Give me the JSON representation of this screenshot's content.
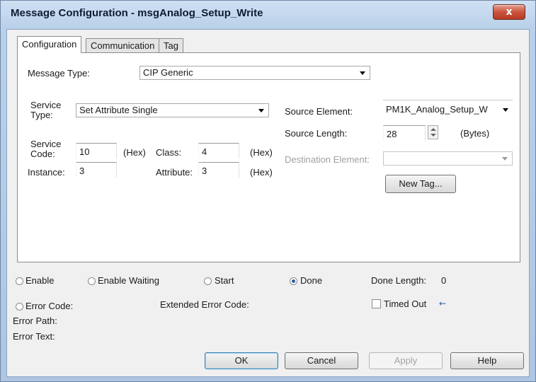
{
  "window": {
    "title": "Message Configuration - msgAnalog_Setup_Write",
    "close_glyph": "x"
  },
  "tabs": [
    {
      "label": "Configuration",
      "active": true
    },
    {
      "label": "Communication",
      "active": false
    },
    {
      "label": "Tag",
      "active": false
    }
  ],
  "config": {
    "message_type_label": "Message Type:",
    "message_type_value": "CIP Generic",
    "service_type_label_1": "Service",
    "service_type_label_2": "Type:",
    "service_type_value": "Set Attribute Single",
    "service_code_label_1": "Service",
    "service_code_label_2": "Code:",
    "service_code_value": "10",
    "hex_label": "(Hex)",
    "class_label": "Class:",
    "class_value": "4",
    "instance_label": "Instance:",
    "instance_value": "3",
    "attribute_label": "Attribute:",
    "attribute_value": "3",
    "source_element_label": "Source Element:",
    "source_element_value": "PM1K_Analog_Setup_W",
    "source_length_label": "Source Length:",
    "source_length_value": "28",
    "bytes_label": "(Bytes)",
    "destination_element_label": "Destination Element:",
    "destination_element_value": "",
    "new_tag_label": "New Tag..."
  },
  "status": {
    "enable_label": "Enable",
    "enable_waiting_label": "Enable Waiting",
    "start_label": "Start",
    "done_label": "Done",
    "done_selected": true,
    "done_length_label": "Done Length:",
    "done_length_value": "0",
    "error_code_label": "Error Code:",
    "extended_error_code_label": "Extended Error Code:",
    "timed_out_label": "Timed Out",
    "timed_out_checked": false,
    "error_path_label": "Error Path:",
    "error_text_label": "Error Text:"
  },
  "buttons": {
    "ok": "OK",
    "cancel": "Cancel",
    "apply": "Apply",
    "help": "Help"
  },
  "colors": {
    "accent_blue": "#2a5ea8",
    "close_red": "#c9533d"
  }
}
